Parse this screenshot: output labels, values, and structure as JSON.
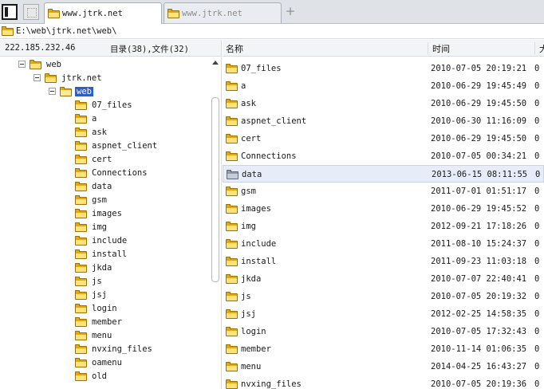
{
  "tabs": [
    {
      "label": "www.jtrk.net",
      "active": true
    },
    {
      "label": "www.jtrk.net",
      "active": false
    }
  ],
  "address": {
    "path": "E:\\web\\jtrk.net\\web\\"
  },
  "status": {
    "ip": "222.185.232.46",
    "counts": "目录(38),文件(32)"
  },
  "columns": {
    "name": "名称",
    "time": "时间",
    "size": "大"
  },
  "tree": {
    "root": "web",
    "site": "jtrk.net",
    "current": "web",
    "children": [
      "07_files",
      "a",
      "ask",
      "aspnet_client",
      "cert",
      "Connections",
      "data",
      "gsm",
      "images",
      "img",
      "include",
      "install",
      "jkda",
      "js",
      "jsj",
      "login",
      "member",
      "menu",
      "nvxing_files",
      "oamenu",
      "old"
    ]
  },
  "files": [
    {
      "name": "07_files",
      "time": "2010-07-05 20:19:21",
      "size": "0"
    },
    {
      "name": "a",
      "time": "2010-06-29 19:45:49",
      "size": "0"
    },
    {
      "name": "ask",
      "time": "2010-06-29 19:45:50",
      "size": "0"
    },
    {
      "name": "aspnet_client",
      "time": "2010-06-30 11:16:09",
      "size": "0"
    },
    {
      "name": "cert",
      "time": "2010-06-29 19:45:50",
      "size": "0"
    },
    {
      "name": "Connections",
      "time": "2010-07-05 00:34:21",
      "size": "0"
    },
    {
      "name": "data",
      "time": "2013-06-15 08:11:55",
      "size": "0",
      "highlighted": true
    },
    {
      "name": "gsm",
      "time": "2011-07-01 01:51:17",
      "size": "0"
    },
    {
      "name": "images",
      "time": "2010-06-29 19:45:52",
      "size": "0"
    },
    {
      "name": "img",
      "time": "2012-09-21 17:18:26",
      "size": "0"
    },
    {
      "name": "include",
      "time": "2011-08-10 15:24:37",
      "size": "0"
    },
    {
      "name": "install",
      "time": "2011-09-23 11:03:18",
      "size": "0"
    },
    {
      "name": "jkda",
      "time": "2010-07-07 22:40:41",
      "size": "0"
    },
    {
      "name": "js",
      "time": "2010-07-05 20:19:32",
      "size": "0"
    },
    {
      "name": "jsj",
      "time": "2012-02-25 14:58:35",
      "size": "0"
    },
    {
      "name": "login",
      "time": "2010-07-05 17:32:43",
      "size": "0"
    },
    {
      "name": "member",
      "time": "2010-11-14 01:06:35",
      "size": "0"
    },
    {
      "name": "menu",
      "time": "2014-04-25 16:43:27",
      "size": "0"
    },
    {
      "name": "nvxing_files",
      "time": "2010-07-05 20:19:36",
      "size": "0"
    }
  ]
}
